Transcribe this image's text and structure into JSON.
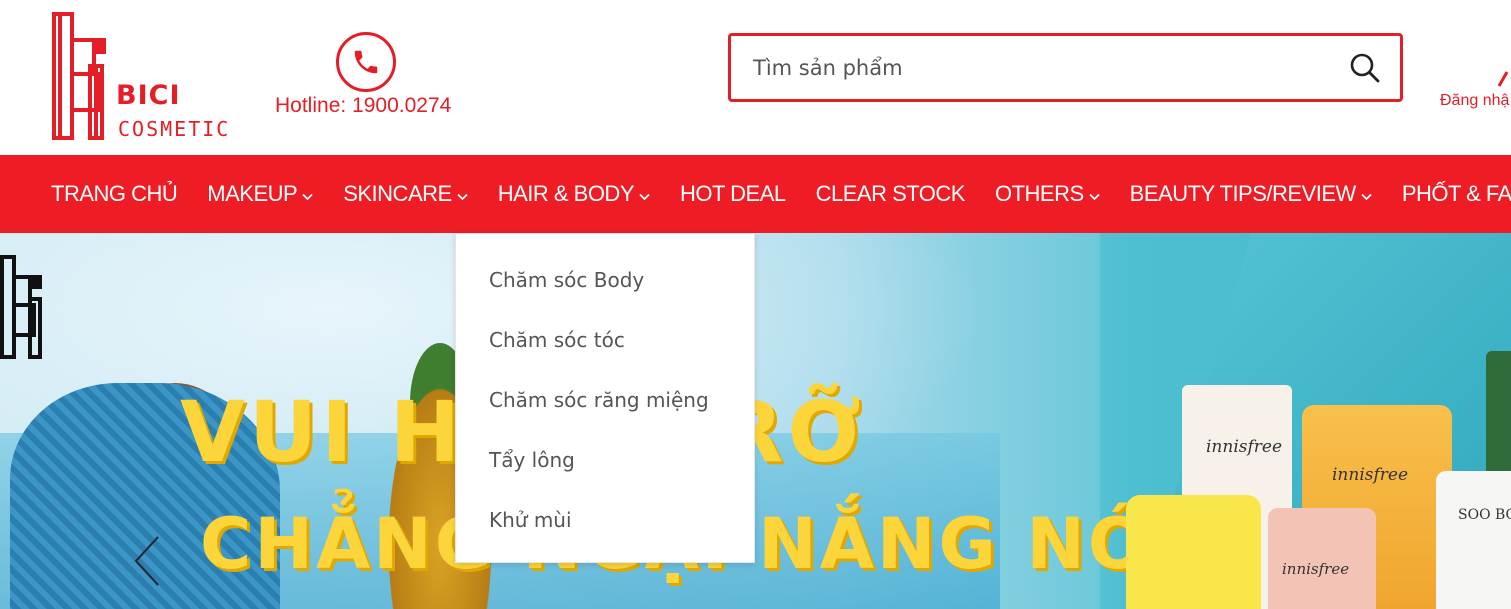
{
  "brand": {
    "name": "BICI",
    "sub": "COSMETIC",
    "accent_color": "#ee1c25"
  },
  "hotline": {
    "icon": "phone-icon",
    "text": "Hotline: 1900.0274"
  },
  "search": {
    "placeholder": "Tìm sản phẩm",
    "value": "",
    "button_icon": "search-icon"
  },
  "account": {
    "login_text": "Đăng nhậ",
    "icon": "user-icon"
  },
  "nav": {
    "items": [
      {
        "label": "TRANG CHỦ",
        "has_dropdown": false
      },
      {
        "label": "MAKEUP",
        "has_dropdown": true
      },
      {
        "label": "SKINCARE",
        "has_dropdown": true
      },
      {
        "label": "HAIR & BODY",
        "has_dropdown": true
      },
      {
        "label": "HOT DEAL",
        "has_dropdown": false
      },
      {
        "label": "CLEAR STOCK",
        "has_dropdown": false
      },
      {
        "label": "OTHERS",
        "has_dropdown": true
      },
      {
        "label": "BEAUTY TIPS/REVIEW",
        "has_dropdown": true
      },
      {
        "label": "PHỐT & FAKE",
        "has_dropdown": true
      }
    ]
  },
  "dropdown": {
    "parent": "HAIR & BODY",
    "items": [
      "Chăm sóc Body",
      "Chăm sóc tóc",
      "Chăm sóc răng miệng",
      "Tẩy lông",
      "Khử mùi"
    ]
  },
  "banner": {
    "headline_line1": "VUI HỪNG RỠ",
    "headline_line2": "CHẲNG NGẠI NẮNG NÓNG",
    "products": [
      "innisfree",
      "innisfree",
      "innisfree",
      "SOO BO"
    ],
    "prev_icon": "chevron-left-icon"
  }
}
